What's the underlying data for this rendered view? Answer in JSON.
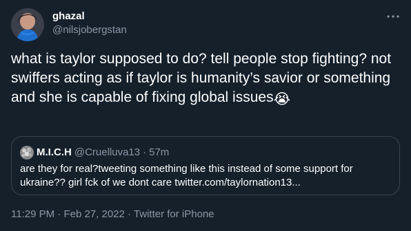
{
  "author": {
    "display_name": "ghazal",
    "handle": "@nilsjobergstan"
  },
  "tweet": {
    "text": "what is taylor supposed to do? tell people stop fighting? not swiffers acting as if taylor is humanity’s savior or something and she is capable of fixing global issues",
    "emoji": "😭"
  },
  "quote": {
    "display_name": "M.I.C.H",
    "handle": "@Cruelluva13",
    "separator": "·",
    "time": "57m",
    "text": "are they for real?tweeting something like this instead of some support for ukraine?? girl fck of we dont care twitter.com/taylornation13..."
  },
  "meta": {
    "time": "11:29 PM",
    "date": "Feb 27, 2022",
    "source": "Twitter for iPhone",
    "separator": "·"
  },
  "icons": {
    "more": "more-horizontal-icon"
  },
  "colors": {
    "background": "#15202b",
    "text_primary": "#ffffff",
    "text_secondary": "#8b98a5",
    "border": "#38444d"
  }
}
